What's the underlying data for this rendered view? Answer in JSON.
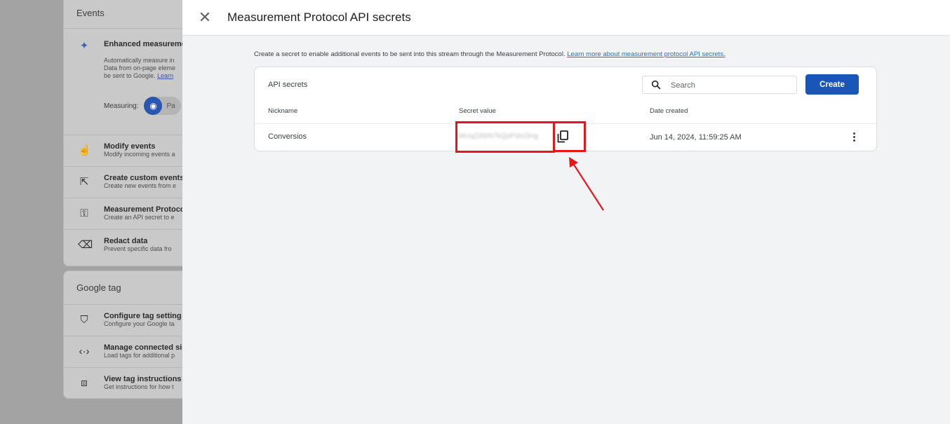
{
  "background": {
    "events_card": {
      "title": "Events",
      "enhanced": {
        "title": "Enhanced measureme",
        "desc_lines": [
          "Automatically measure in",
          "Data from on-page eleme",
          "be sent to Google."
        ],
        "learn_link": "Learn",
        "measuring_label": "Measuring:",
        "measuring_value": "Pa"
      },
      "rows": [
        {
          "title": "Modify events",
          "desc": "Modify incoming events a"
        },
        {
          "title": "Create custom events",
          "desc": "Create new events from e"
        },
        {
          "title": "Measurement Protoco",
          "desc": "Create an API secret to e"
        },
        {
          "title": "Redact data",
          "desc": "Prevent specific data fro"
        }
      ]
    },
    "gtag_card": {
      "title": "Google tag",
      "rows": [
        {
          "title": "Configure tag setting",
          "desc": "Configure your Google ta"
        },
        {
          "title": "Manage connected si",
          "desc": "Load tags for additional p"
        },
        {
          "title": "View tag instructions",
          "desc": "Get instructions for how t"
        }
      ]
    }
  },
  "drawer": {
    "title": "Measurement Protocol API secrets",
    "intro_text": "Create a secret to enable additional events to be sent into this stream through the Measurement Protocol.",
    "intro_link": "Learn more about measurement protocol API secrets.",
    "table": {
      "title": "API secrets",
      "search_placeholder": "Search",
      "create_label": "Create",
      "headers": {
        "nickname": "Nickname",
        "secret": "Secret value",
        "date": "Date created"
      },
      "rows": [
        {
          "nickname": "Conversios",
          "secret": "bKrqZd9iN7kQpPdsOlng",
          "date": "Jun 14, 2024, 11:59:25 AM"
        }
      ]
    }
  },
  "icons": {
    "close": "close-icon",
    "search": "search-icon",
    "copy": "copy-icon",
    "more": "more-vert-icon"
  },
  "colors": {
    "accent": "#1a56b8",
    "highlight": "#e4171a",
    "link": "#1a73e8"
  }
}
